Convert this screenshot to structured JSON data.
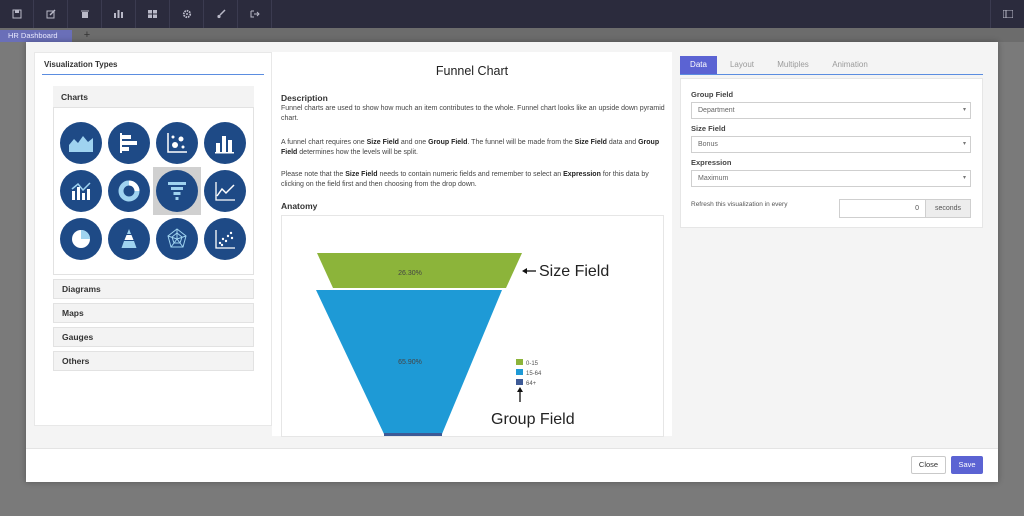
{
  "toolbar": {
    "left_icons": [
      "save-icon",
      "edit-icon",
      "trash-icon",
      "bar-chart-icon",
      "grid-icon",
      "gear-icon",
      "brush-icon",
      "export-icon"
    ],
    "right_icon": "menu-icon"
  },
  "dashboard_tab": {
    "label": "HR Dashboard",
    "add_label": "+"
  },
  "left": {
    "title": "Visualization Types",
    "charts_header": "Charts",
    "chart_icons": [
      "area-chart-icon",
      "horizontal-bar-chart-icon",
      "bubble-chart-icon",
      "column-chart-icon",
      "combo-chart-icon",
      "donut-chart-icon",
      "funnel-chart-icon",
      "line-chart-icon",
      "pie-chart-icon",
      "pyramid-chart-icon",
      "radar-chart-icon",
      "scatter-chart-icon"
    ],
    "selected_icon": "funnel-chart-icon",
    "sections": [
      "Diagrams",
      "Maps",
      "Gauges",
      "Others"
    ]
  },
  "middle": {
    "title": "Funnel Chart",
    "description_heading": "Description",
    "p1": "Funnel charts are used to show how much an item contributes to the whole. Funnel chart looks like an upside down pyramid chart.",
    "p2_a": "A funnel chart requires one ",
    "p2_b": "Size Field",
    "p2_c": " and one ",
    "p2_d": "Group Field",
    "p2_e": ". The funnel will be made from the ",
    "p2_f": "Size Field",
    "p2_g": " data and ",
    "p2_h": "Group Field",
    "p2_i": " determines how the levels will be split.",
    "p3_a": "Please note that the ",
    "p3_b": "Size Field",
    "p3_c": " needs to contain numeric fields and remember to select an ",
    "p3_d": "Expression",
    "p3_e": " for this data by clicking on the field first and then choosing from the drop down.",
    "anatomy_heading": "Anatomy",
    "anatomy": {
      "top_label": "26.30%",
      "mid_label": "65.90%",
      "legend": [
        "0-15",
        "15-64",
        "64+"
      ],
      "size_field_label": "Size Field",
      "group_field_label": "Group Field",
      "colors": {
        "top": "#8cb43a",
        "mid": "#1e9ad6",
        "bottom": "#3d5a96"
      }
    }
  },
  "right": {
    "tabs": [
      "Data",
      "Layout",
      "Multiples",
      "Animation"
    ],
    "active_tab": "Data",
    "group_field_label": "Group Field",
    "group_field_value": "Department",
    "size_field_label": "Size Field",
    "size_field_value": "Bonus",
    "expression_label": "Expression",
    "expression_value": "Maximum",
    "refresh_label": "Refresh this visualization in every",
    "refresh_value": "0",
    "refresh_unit": "seconds"
  },
  "footer": {
    "close_label": "Close",
    "save_label": "Save"
  },
  "colors": {
    "accent": "#5b63d3",
    "icon_blue": "#1e4a86",
    "toolbar": "#2b2b3d"
  }
}
